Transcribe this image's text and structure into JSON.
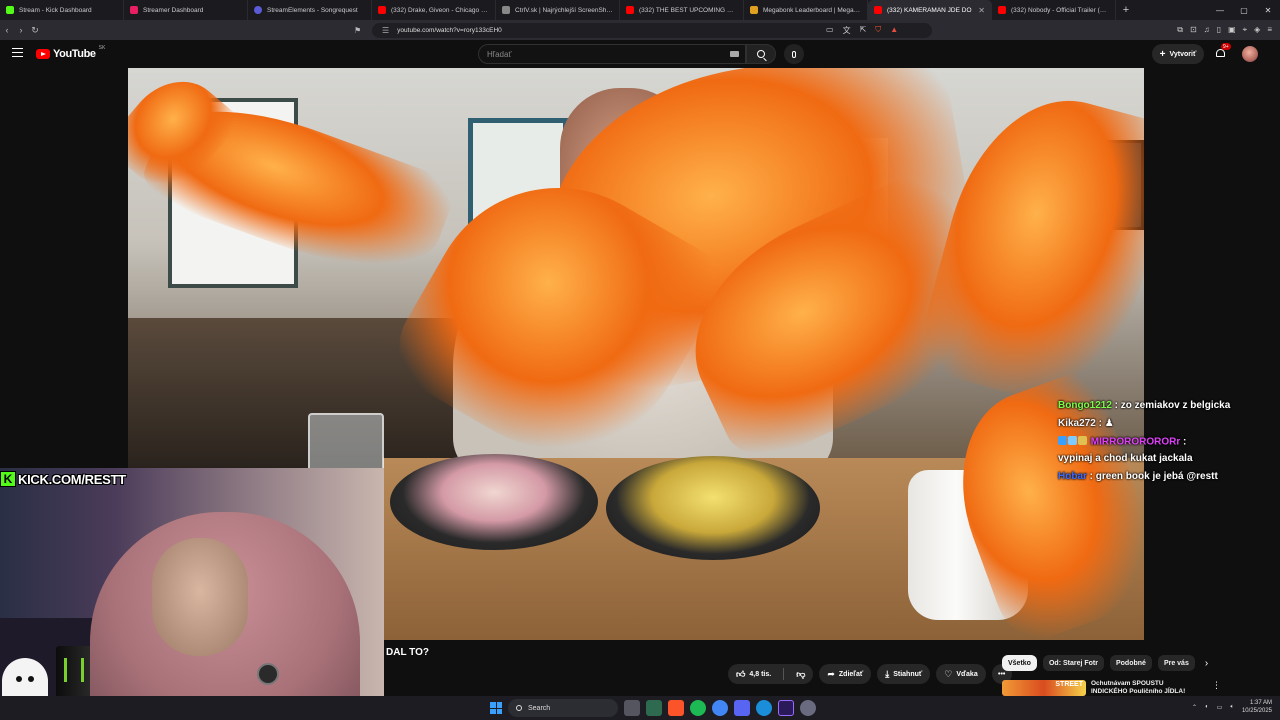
{
  "browser": {
    "tabs": [
      {
        "title": "Stream - Kick Dashboard",
        "color": "#53fc18"
      },
      {
        "title": "Streamer Dashboard",
        "color": "#e91e63"
      },
      {
        "title": "StreamElements - Songrequest",
        "color": "#5a5bd6"
      },
      {
        "title": "(332) Drake, Giveon - Chicago Freest",
        "color": "#ff0000"
      },
      {
        "title": "CtrlV.sk | Najrýchlejší ScreenShot a P",
        "color": "#888888"
      },
      {
        "title": "(332) THE BEST UPCOMING MOVIES",
        "color": "#ff0000"
      },
      {
        "title": "Megabonk Leaderboard | Megabonk",
        "color": "#e0a020"
      },
      {
        "title": "(332) KAMERAMAN JDE DO",
        "color": "#ff0000",
        "active": true
      },
      {
        "title": "(332) Nobody - Official Trailer (HD)",
        "color": "#ff0000"
      }
    ],
    "url": "youtube.com/watch?v=rory133cEH0"
  },
  "youtube": {
    "logo_text": "YouTube",
    "country_code": "SK",
    "search_placeholder": "Hľadať",
    "create_label": "Vytvoriť",
    "notif_badge": "9+",
    "video_title_tail": "DAL TO?",
    "like_count": "4,8 tis.",
    "share_label": "Zdieľať",
    "download_label": "Stiahnuť",
    "thanks_label": "Vďaka",
    "chips": [
      "Všetko",
      "Od: Starej Fotr",
      "Podobné",
      "Pre vás"
    ],
    "recommendation": {
      "thumb_text": "STREET",
      "title": "Ochutnávam SPOUSTU INDICKÉHO Pouličního JÍDLA!"
    }
  },
  "stream_overlay": {
    "kick_label": "KICK.COM/RESTT",
    "chat": [
      {
        "user": "Bongo1212",
        "user_color": "#7cfc4a",
        "text": "zo zemiakov z belgicka"
      },
      {
        "user": "Kika272",
        "user_color": "#f4f4f4",
        "text": "♟"
      },
      {
        "user": "MIRRORORORORr",
        "user_color": "#e040fb",
        "text": "vypinaj a chod kukat jackala"
      },
      {
        "user": "Hobar",
        "user_color": "#3a6bff",
        "text": "green book je jebá @restt"
      }
    ]
  },
  "taskbar": {
    "search_placeholder": "Search",
    "time": "1:37 AM",
    "date": "10/25/2025"
  }
}
